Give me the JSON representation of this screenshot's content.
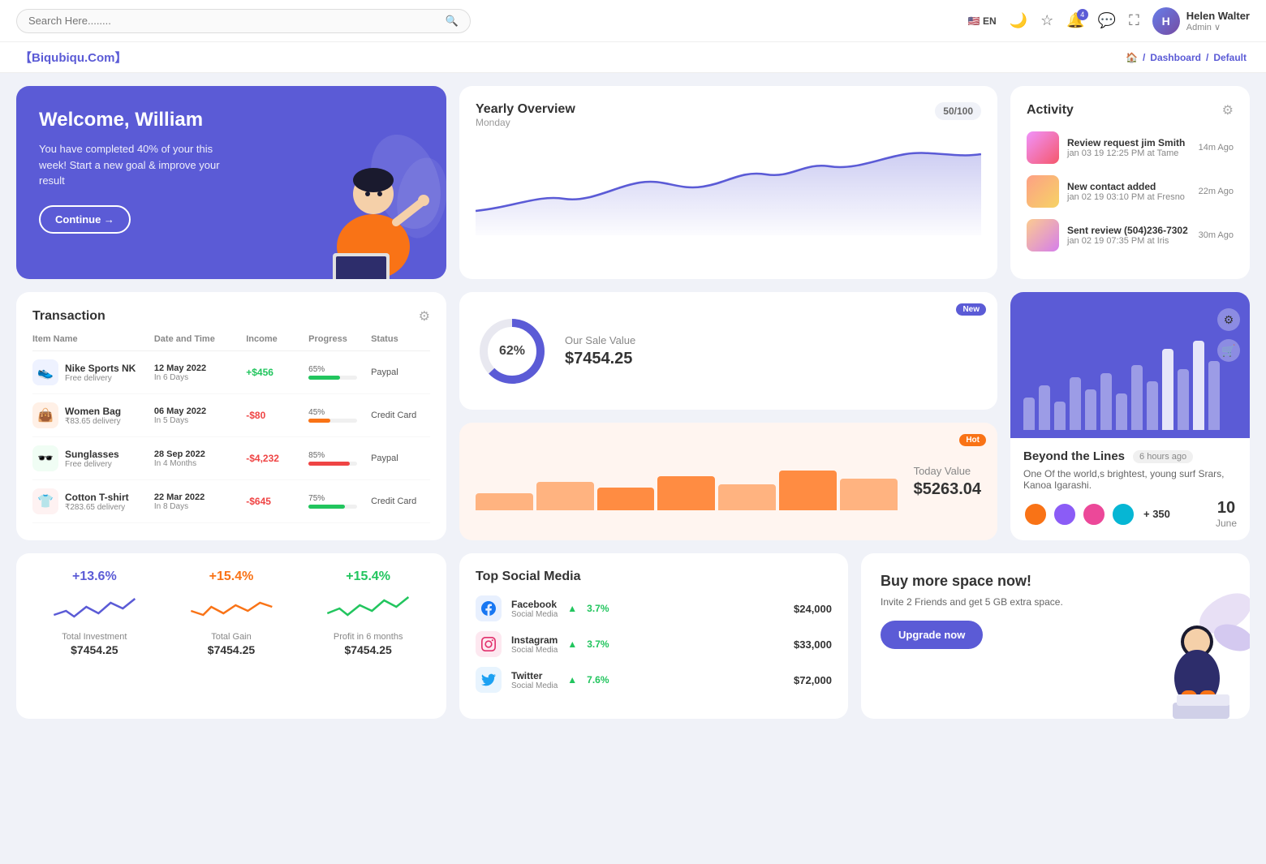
{
  "topnav": {
    "search_placeholder": "Search Here........",
    "lang": "EN",
    "username": "Helen Walter",
    "user_role": "Admin ∨"
  },
  "breadcrumb": {
    "brand": "【Biqubiqu.Com】",
    "home": "⌂",
    "path": [
      "Dashboard",
      "Default"
    ]
  },
  "welcome": {
    "title": "Welcome, William",
    "subtitle": "You have completed 40% of your this week! Start a new goal & improve your result",
    "button": "Continue →"
  },
  "yearly": {
    "title": "Yearly Overview",
    "subtitle": "Monday",
    "score": "50/100"
  },
  "activity": {
    "title": "Activity",
    "items": [
      {
        "title": "Review request jim Smith",
        "subtitle": "jan 03 19 12:25 PM at Tame",
        "time": "14m Ago"
      },
      {
        "title": "New contact added",
        "subtitle": "jan 02 19 03:10 PM at Fresno",
        "time": "22m Ago"
      },
      {
        "title": "Sent review (504)236-7302",
        "subtitle": "jan 02 19 07:35 PM at Iris",
        "time": "30m Ago"
      }
    ]
  },
  "transaction": {
    "title": "Transaction",
    "columns": [
      "Item Name",
      "Date and Time",
      "Income",
      "Progress",
      "Status"
    ],
    "rows": [
      {
        "icon": "👟",
        "icon_bg": "#eef2ff",
        "name": "Nike Sports NK",
        "sub": "Free delivery",
        "date": "12 May 2022",
        "date_sub": "In 6 Days",
        "income": "+$456",
        "income_type": "pos",
        "progress": 65,
        "progress_color": "#22c55e",
        "status": "Paypal"
      },
      {
        "icon": "👜",
        "icon_bg": "#fff0e6",
        "name": "Women Bag",
        "sub": "₹83.65 delivery",
        "date": "06 May 2022",
        "date_sub": "In 5 Days",
        "income": "-$80",
        "income_type": "neg",
        "progress": 45,
        "progress_color": "#f97316",
        "status": "Credit Card"
      },
      {
        "icon": "🕶️",
        "icon_bg": "#f0fdf4",
        "name": "Sunglasses",
        "sub": "Free delivery",
        "date": "28 Sep 2022",
        "date_sub": "In 4 Months",
        "income": "-$4,232",
        "income_type": "neg",
        "progress": 85,
        "progress_color": "#ef4444",
        "status": "Paypal"
      },
      {
        "icon": "👕",
        "icon_bg": "#fef2f2",
        "name": "Cotton T-shirt",
        "sub": "₹283.65 delivery",
        "date": "22 Mar 2022",
        "date_sub": "In 8 Days",
        "income": "-$645",
        "income_type": "neg",
        "progress": 75,
        "progress_color": "#22c55e",
        "status": "Credit Card"
      }
    ]
  },
  "sale_value": {
    "label": "Our Sale Value",
    "value": "$7454.25",
    "percent": "62%",
    "badge": "New"
  },
  "today_value": {
    "label": "Today Value",
    "value": "$5263.04",
    "badge": "Hot",
    "bars": [
      30,
      50,
      40,
      60,
      45,
      70,
      55
    ]
  },
  "beyond": {
    "title": "Beyond the Lines",
    "time": "6 hours ago",
    "desc": "One Of the world,s brightest, young surf Srars, Kanoa Igarashi.",
    "plus_count": "+ 350",
    "date_num": "10",
    "date_month": "June",
    "bars": [
      40,
      55,
      35,
      65,
      50,
      70,
      45,
      80,
      60,
      90,
      75,
      100,
      85
    ]
  },
  "stats": [
    {
      "pct": "+13.6%",
      "color": "purple",
      "label": "Total Investment",
      "value": "$7454.25"
    },
    {
      "pct": "+15.4%",
      "color": "orange",
      "label": "Total Gain",
      "value": "$7454.25"
    },
    {
      "pct": "+15.4%",
      "color": "green",
      "label": "Profit in 6 months",
      "value": "$7454.25"
    }
  ],
  "social": {
    "title": "Top Social Media",
    "items": [
      {
        "name": "Facebook",
        "sub": "Social Media",
        "icon": "f",
        "type": "fb",
        "change": "3.7%",
        "amount": "$24,000"
      },
      {
        "name": "Instagram",
        "sub": "Social Media",
        "icon": "ig",
        "type": "ig",
        "change": "3.7%",
        "amount": "$33,000"
      },
      {
        "name": "Twitter",
        "sub": "Social Media",
        "icon": "t",
        "type": "tw",
        "change": "7.6%",
        "amount": "$72,000"
      }
    ]
  },
  "buy_space": {
    "title": "Buy more space now!",
    "desc": "Invite 2 Friends and get 5 GB extra space.",
    "button": "Upgrade now"
  }
}
